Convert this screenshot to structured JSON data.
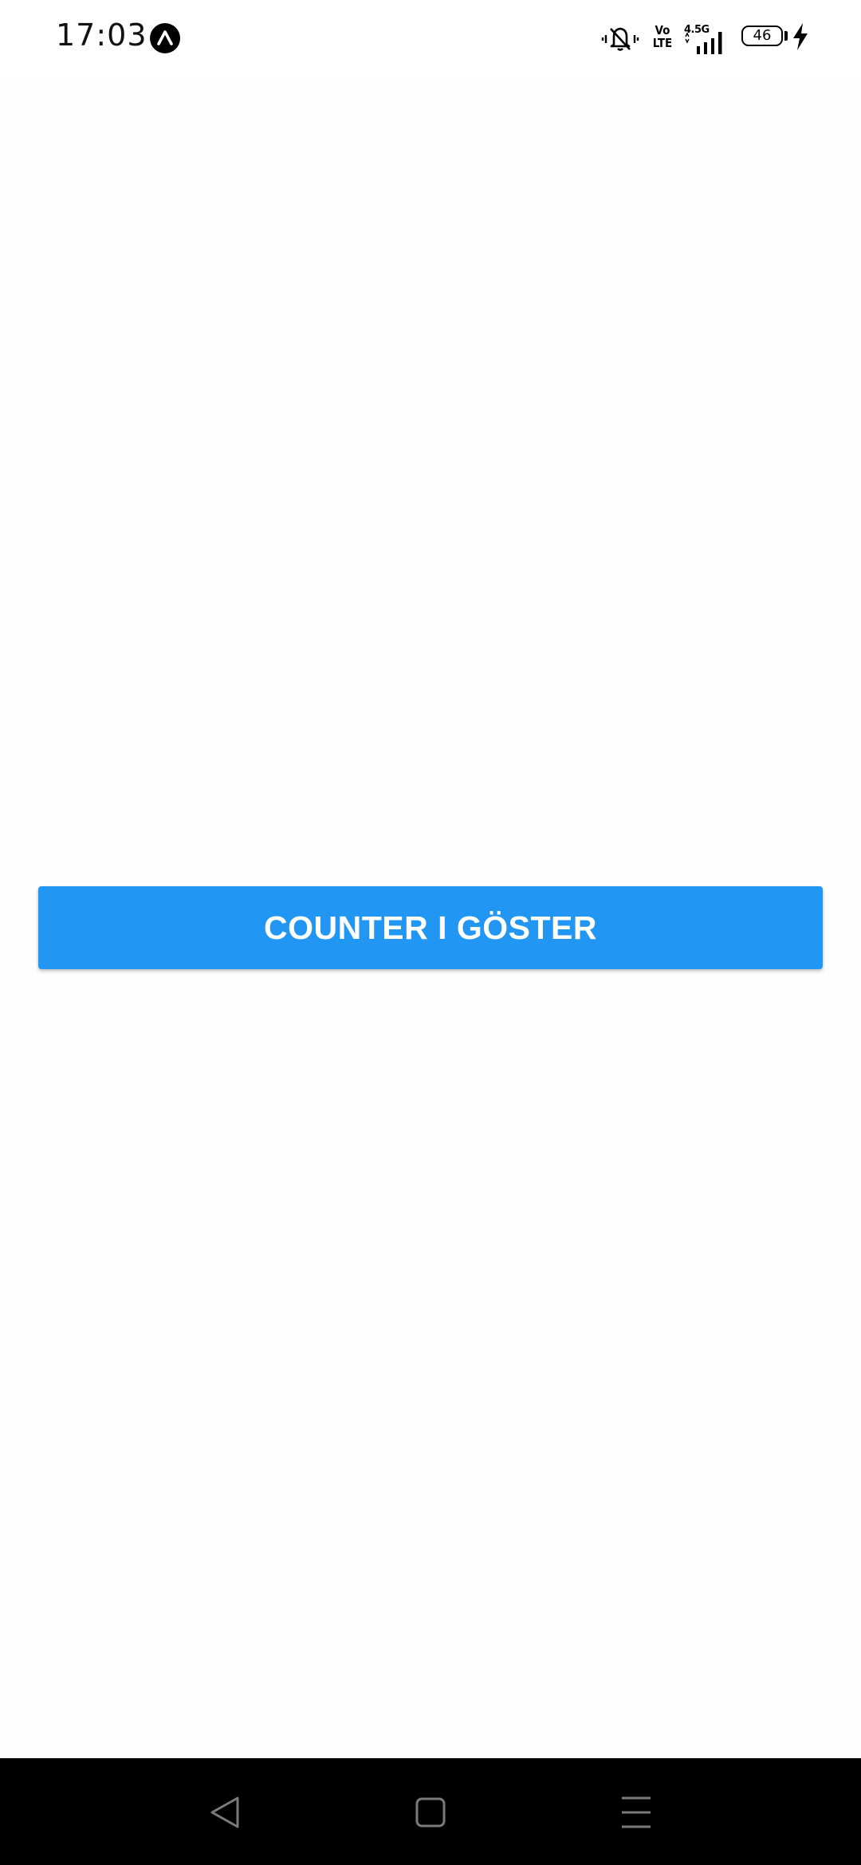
{
  "status_bar": {
    "time": "17:03",
    "network_type": "4.5G",
    "volte_line1": "Vo",
    "volte_line2": "LTE",
    "battery_level": "46",
    "icons": [
      "expo-icon",
      "mute-icon",
      "volte-icon",
      "signal-icon",
      "battery-icon",
      "charging-icon"
    ]
  },
  "main": {
    "button_label": "COUNTER I GÖSTER",
    "button_color": "#2196f3"
  },
  "nav_bar": {
    "icons": [
      "back-icon",
      "home-icon",
      "menu-icon"
    ]
  }
}
